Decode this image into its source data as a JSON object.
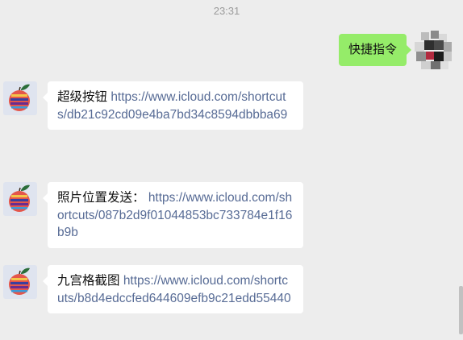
{
  "chat": {
    "timestamp": "23:31",
    "outgoing": {
      "text": "快捷指令"
    },
    "incoming": [
      {
        "prefix": "超级按钮 ",
        "link": "https://www.icloud.com/shortcuts/db21c92cd09e4ba7bd34c8594dbbba69"
      },
      {
        "prefix": "照片位置发送： ",
        "link": "https://www.icloud.com/shortcuts/087b2d9f01044853bc733784e1f16b9b"
      },
      {
        "prefix": "九宫格截图 ",
        "link": "https://www.icloud.com/shortcuts/b8d4edccfed644609efb9c21edd55440"
      }
    ]
  },
  "colors": {
    "background": "#ededed",
    "outgoing_bubble": "#95ec69",
    "incoming_bubble": "#ffffff",
    "link": "#576b95"
  },
  "icons": {
    "sender_avatar": "apple-avatar-icon",
    "self_avatar": "pixelated-avatar-icon"
  }
}
